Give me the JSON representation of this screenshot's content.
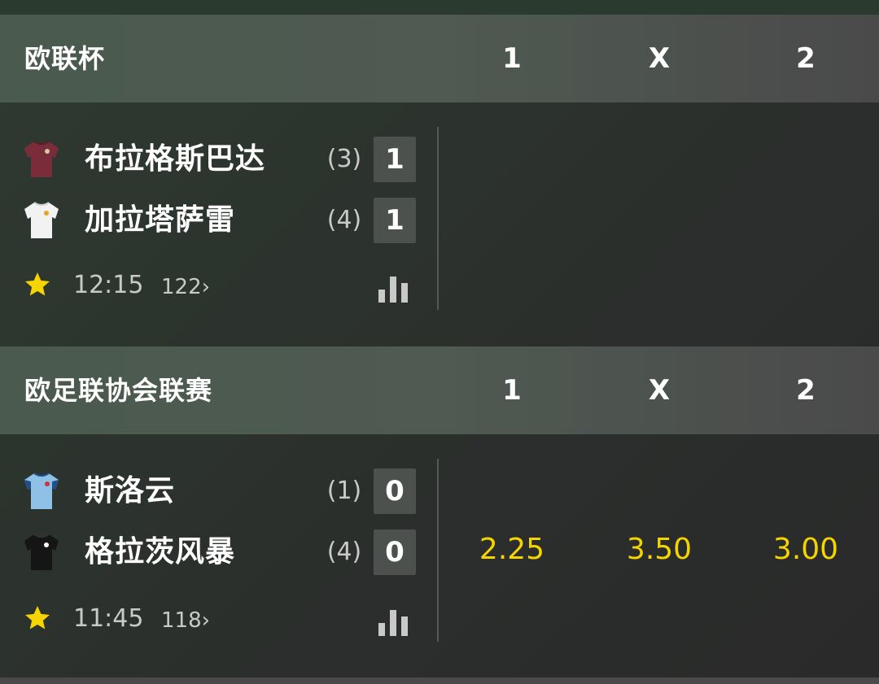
{
  "colors": {
    "odds": "#f5d400",
    "star": "#f5d400",
    "score_bg": "#4d514e"
  },
  "leagues": [
    {
      "name": "欧联杯",
      "columns": [
        "1",
        "X",
        "2"
      ],
      "match": {
        "home": {
          "name": "布拉格斯巴达",
          "seed": "(3)",
          "score": "1",
          "shirt_icon": "maroon-shirt-icon"
        },
        "away": {
          "name": "加拉塔萨雷",
          "seed": "(4)",
          "score": "1",
          "shirt_icon": "white-shirt-icon"
        },
        "time": "12:15",
        "markets": "122",
        "odds": []
      }
    },
    {
      "name": "欧足联协会联赛",
      "columns": [
        "1",
        "X",
        "2"
      ],
      "match": {
        "home": {
          "name": "斯洛云",
          "seed": "(1)",
          "score": "0",
          "shirt_icon": "light-blue-shirt-icon"
        },
        "away": {
          "name": "格拉茨风暴",
          "seed": "(4)",
          "score": "0",
          "shirt_icon": "black-shirt-icon"
        },
        "time": "11:45",
        "markets": "118",
        "odds": [
          "2.25",
          "3.50",
          "3.00"
        ]
      }
    }
  ]
}
